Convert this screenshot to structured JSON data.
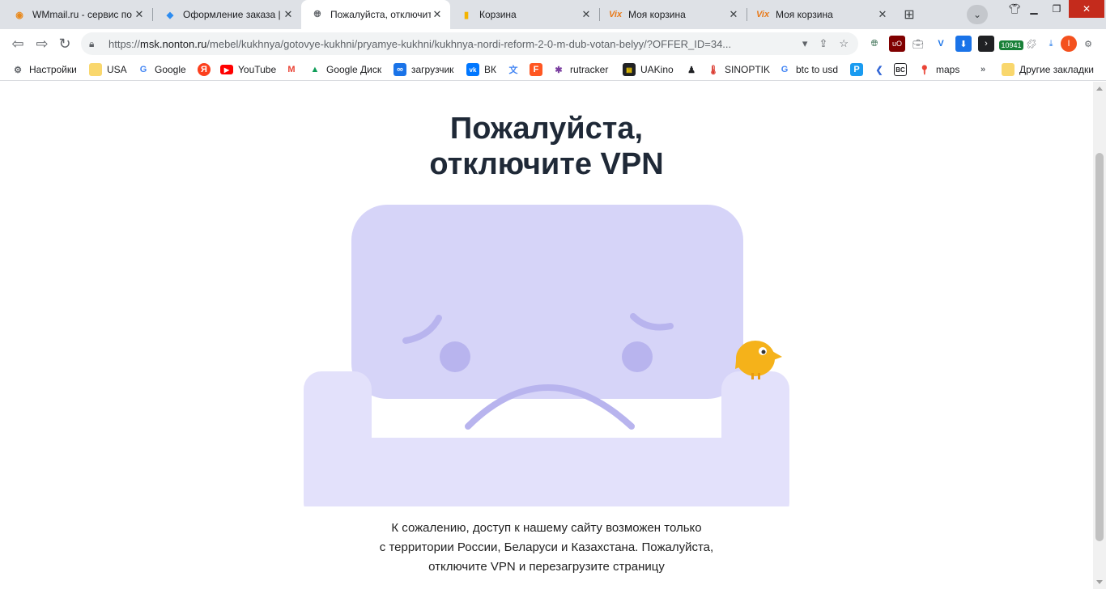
{
  "tabs": [
    {
      "title": "WMmail.ru - сервис по",
      "favicon": "wmmail-icon",
      "active": false
    },
    {
      "title": "Оформление заказа | и",
      "favicon": "order-icon",
      "active": false
    },
    {
      "title": "Пожалуйста, отключите",
      "favicon": "globe-icon",
      "active": true
    },
    {
      "title": "Корзина",
      "favicon": "sheets-icon",
      "active": false
    },
    {
      "title": "Моя корзина",
      "favicon": "vix-icon",
      "active": false
    },
    {
      "title": "Моя корзина",
      "favicon": "vix-icon",
      "active": false
    }
  ],
  "toolbar": {
    "url_prefix": "https://",
    "url_host": "msk.nonton.ru",
    "url_path": "/mebel/kukhnya/gotovye-kukhni/pryamye-kukhni/kukhnya-nordi-reform-2-0-m-dub-votan-belyy/?OFFER_ID=34...",
    "extension_badge": "10941",
    "profile_initial": "I"
  },
  "bookmarks": [
    {
      "label": "Настройки",
      "icon": "gear-icon"
    },
    {
      "label": "USA",
      "icon": "folder-icon"
    },
    {
      "label": "Google",
      "icon": "google-icon"
    },
    {
      "label": "",
      "icon": "yandex-icon"
    },
    {
      "label": "YouTube",
      "icon": "youtube-icon"
    },
    {
      "label": "",
      "icon": "gmail-icon"
    },
    {
      "label": "Google Диск",
      "icon": "google-drive-icon"
    },
    {
      "label": "загрузчик",
      "icon": "infinity-icon"
    },
    {
      "label": "ВК",
      "icon": "vk-icon"
    },
    {
      "label": "",
      "icon": "translate-icon"
    },
    {
      "label": "",
      "icon": "f-icon"
    },
    {
      "label": "rutracker",
      "icon": "rutracker-icon"
    },
    {
      "label": "UAKino",
      "icon": "uakino-icon"
    },
    {
      "label": "",
      "icon": "chess-icon"
    },
    {
      "label": "SINOPTIK",
      "icon": "thermometer-icon"
    },
    {
      "label": "btc to usd",
      "icon": "google-icon"
    },
    {
      "label": "",
      "icon": "p-icon"
    },
    {
      "label": "",
      "icon": "chevron-icon"
    },
    {
      "label": "",
      "icon": "bc-icon"
    },
    {
      "label": "maps",
      "icon": "maps-icon"
    },
    {
      "label": "Другие закладки",
      "icon": "folder-icon"
    }
  ],
  "page": {
    "headline_line1": "Пожалуйста,",
    "headline_line2": "отключите VPN",
    "message_line1": "К сожалению, доступ к нашему сайту возможен только",
    "message_line2": "с территории России, Беларуси и Казахстана. Пожалуйста,",
    "message_line3": "отключите VPN и перезагрузите страницу"
  },
  "colors": {
    "sofa_light": "#e3e1fb",
    "sofa_mid": "#d6d4f8",
    "sofa_dark": "#bcb8f0",
    "face": "#b8b4ee",
    "bird": "#f5b21a"
  }
}
